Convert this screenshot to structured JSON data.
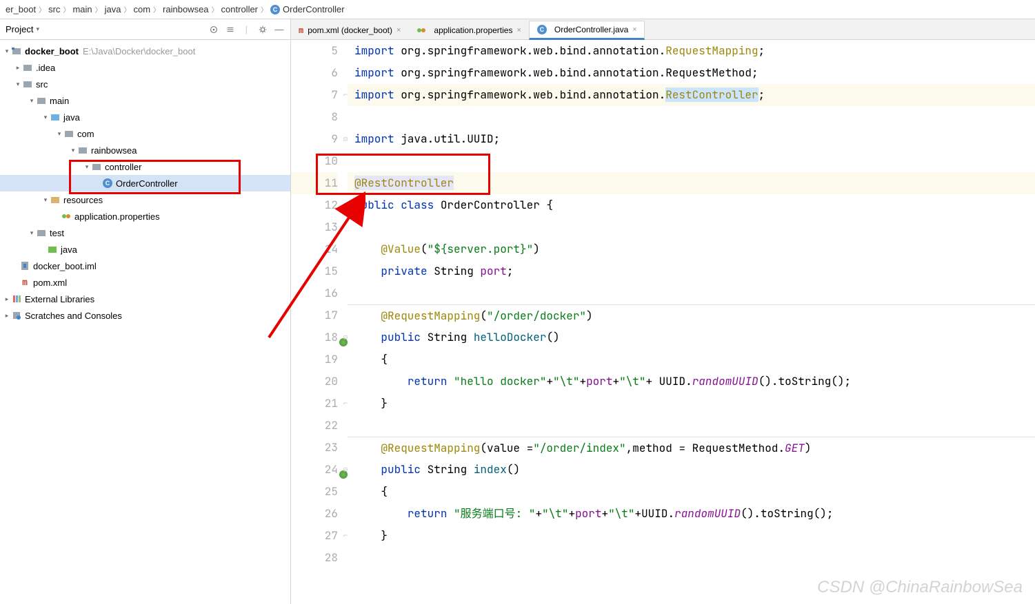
{
  "breadcrumbs": [
    "er_boot",
    "src",
    "main",
    "java",
    "com",
    "rainbowsea",
    "controller",
    "OrderController"
  ],
  "sidebar": {
    "title": "Project",
    "root": {
      "name": "docker_boot",
      "path": "E:\\Java\\Docker\\docker_boot"
    }
  },
  "tree": {
    "idea": ".idea",
    "src": "src",
    "main": "main",
    "java": "java",
    "com": "com",
    "rainbowsea": "rainbowsea",
    "controller": "controller",
    "orderController": "OrderController",
    "resources": "resources",
    "appProps": "application.properties",
    "test": "test",
    "testJava": "java",
    "iml": "docker_boot.iml",
    "pom": "pom.xml",
    "extLibs": "External Libraries",
    "scratches": "Scratches and Consoles"
  },
  "tabs": [
    {
      "label": "pom.xml (docker_boot)",
      "active": false
    },
    {
      "label": "application.properties",
      "active": false
    },
    {
      "label": "OrderController.java",
      "active": true
    }
  ],
  "code": {
    "lines": [
      5,
      6,
      7,
      8,
      9,
      10,
      11,
      12,
      13,
      14,
      15,
      16,
      17,
      18,
      19,
      20,
      21,
      22,
      23,
      24,
      25,
      26,
      27,
      28
    ]
  },
  "watermark": "CSDN @ChinaRainbowSea"
}
